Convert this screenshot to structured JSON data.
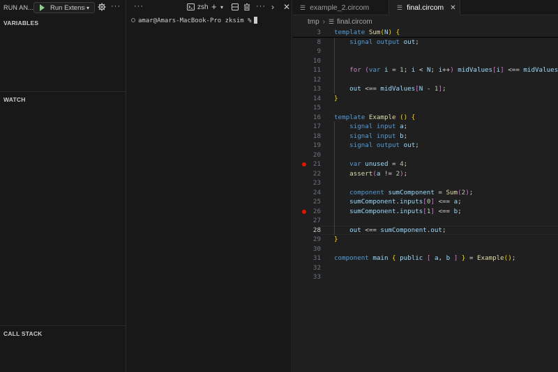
{
  "debug": {
    "title": "RUN AN...",
    "run_config": "Run Extensi",
    "more": "···",
    "sections": {
      "variables": "VARIABLES",
      "watch": "WATCH",
      "call_stack": "CALL STACK"
    }
  },
  "terminal": {
    "more": "···",
    "shell": "zsh",
    "plus": "+",
    "more2": "···",
    "prompt": "amar@Amars-MacBook-Pro zksim %"
  },
  "editor": {
    "tabs": [
      {
        "label": "example_2.circom",
        "active": false
      },
      {
        "label": "final.circom",
        "active": true
      }
    ],
    "breadcrumb": {
      "folder": "tmp",
      "file": "final.circom"
    },
    "lines": [
      {
        "n": "3",
        "tokens": [
          [
            "k",
            "template"
          ],
          [
            "o",
            " "
          ],
          [
            "f",
            "Sum"
          ],
          [
            "b1",
            "("
          ],
          [
            "v",
            "N"
          ],
          [
            "b1",
            ")"
          ],
          [
            "o",
            " "
          ],
          [
            "b1",
            "{"
          ]
        ],
        "sticky": true
      },
      {
        "n": "8",
        "tokens": [
          [
            "o",
            "    "
          ],
          [
            "k",
            "signal"
          ],
          [
            "o",
            " "
          ],
          [
            "k",
            "output"
          ],
          [
            "o",
            " "
          ],
          [
            "v",
            "out"
          ],
          [
            "o",
            ";"
          ]
        ]
      },
      {
        "n": "9",
        "tokens": []
      },
      {
        "n": "10",
        "tokens": []
      },
      {
        "n": "11",
        "tokens": [
          [
            "o",
            "    "
          ],
          [
            "kp",
            "for"
          ],
          [
            "o",
            " "
          ],
          [
            "b2",
            "("
          ],
          [
            "k",
            "var"
          ],
          [
            "o",
            " "
          ],
          [
            "v",
            "i"
          ],
          [
            "o",
            " = "
          ],
          [
            "n",
            "1"
          ],
          [
            "o",
            "; "
          ],
          [
            "v",
            "i"
          ],
          [
            "o",
            " < "
          ],
          [
            "v",
            "N"
          ],
          [
            "o",
            "; "
          ],
          [
            "v",
            "i"
          ],
          [
            "o",
            "++"
          ],
          [
            "b2",
            ")"
          ],
          [
            "o",
            " "
          ],
          [
            "v",
            "midValues"
          ],
          [
            "b2",
            "["
          ],
          [
            "v",
            "i"
          ],
          [
            "b2",
            "]"
          ],
          [
            "o",
            " <== "
          ],
          [
            "v",
            "midValues"
          ],
          [
            "b2",
            "["
          ]
        ]
      },
      {
        "n": "12",
        "tokens": []
      },
      {
        "n": "13",
        "tokens": [
          [
            "o",
            "    "
          ],
          [
            "v",
            "out"
          ],
          [
            "o",
            " <== "
          ],
          [
            "v",
            "midValues"
          ],
          [
            "b2",
            "["
          ],
          [
            "v",
            "N"
          ],
          [
            "o",
            " - "
          ],
          [
            "n",
            "1"
          ],
          [
            "b2",
            "]"
          ],
          [
            "o",
            ";"
          ]
        ]
      },
      {
        "n": "14",
        "tokens": [
          [
            "b1",
            "}"
          ]
        ]
      },
      {
        "n": "15",
        "tokens": []
      },
      {
        "n": "16",
        "tokens": [
          [
            "k",
            "template"
          ],
          [
            "o",
            " "
          ],
          [
            "f",
            "Example"
          ],
          [
            "o",
            " "
          ],
          [
            "b1",
            "()"
          ],
          [
            "o",
            " "
          ],
          [
            "b1",
            "{"
          ]
        ]
      },
      {
        "n": "17",
        "tokens": [
          [
            "o",
            "    "
          ],
          [
            "k",
            "signal"
          ],
          [
            "o",
            " "
          ],
          [
            "k",
            "input"
          ],
          [
            "o",
            " "
          ],
          [
            "v",
            "a"
          ],
          [
            "o",
            ";"
          ]
        ]
      },
      {
        "n": "18",
        "tokens": [
          [
            "o",
            "    "
          ],
          [
            "k",
            "signal"
          ],
          [
            "o",
            " "
          ],
          [
            "k",
            "input"
          ],
          [
            "o",
            " "
          ],
          [
            "v",
            "b"
          ],
          [
            "o",
            ";"
          ]
        ]
      },
      {
        "n": "19",
        "tokens": [
          [
            "o",
            "    "
          ],
          [
            "k",
            "signal"
          ],
          [
            "o",
            " "
          ],
          [
            "k",
            "output"
          ],
          [
            "o",
            " "
          ],
          [
            "v",
            "out"
          ],
          [
            "o",
            ";"
          ]
        ]
      },
      {
        "n": "20",
        "tokens": []
      },
      {
        "n": "21",
        "tokens": [
          [
            "o",
            "    "
          ],
          [
            "k",
            "var"
          ],
          [
            "o",
            " "
          ],
          [
            "v",
            "unused"
          ],
          [
            "o",
            " = "
          ],
          [
            "n",
            "4"
          ],
          [
            "o",
            ";"
          ]
        ],
        "breakpoint": true
      },
      {
        "n": "22",
        "tokens": [
          [
            "o",
            "    "
          ],
          [
            "f",
            "assert"
          ],
          [
            "b2",
            "("
          ],
          [
            "v",
            "a"
          ],
          [
            "o",
            " != "
          ],
          [
            "n",
            "2"
          ],
          [
            "b2",
            ")"
          ],
          [
            "o",
            ";"
          ]
        ]
      },
      {
        "n": "23",
        "tokens": []
      },
      {
        "n": "24",
        "tokens": [
          [
            "o",
            "    "
          ],
          [
            "k",
            "component"
          ],
          [
            "o",
            " "
          ],
          [
            "v",
            "sumComponent"
          ],
          [
            "o",
            " = "
          ],
          [
            "f",
            "Sum"
          ],
          [
            "b2",
            "("
          ],
          [
            "n",
            "2"
          ],
          [
            "b2",
            ")"
          ],
          [
            "o",
            ";"
          ]
        ]
      },
      {
        "n": "25",
        "tokens": [
          [
            "o",
            "    "
          ],
          [
            "v",
            "sumComponent"
          ],
          [
            "o",
            "."
          ],
          [
            "v",
            "inputs"
          ],
          [
            "b2",
            "["
          ],
          [
            "n",
            "0"
          ],
          [
            "b2",
            "]"
          ],
          [
            "o",
            " <== "
          ],
          [
            "v",
            "a"
          ],
          [
            "o",
            ";"
          ]
        ]
      },
      {
        "n": "26",
        "tokens": [
          [
            "o",
            "    "
          ],
          [
            "v",
            "sumComponent"
          ],
          [
            "o",
            "."
          ],
          [
            "v",
            "inputs"
          ],
          [
            "b2",
            "["
          ],
          [
            "n",
            "1"
          ],
          [
            "b2",
            "]"
          ],
          [
            "o",
            " <== "
          ],
          [
            "v",
            "b"
          ],
          [
            "o",
            ";"
          ]
        ],
        "breakpoint": true
      },
      {
        "n": "27",
        "tokens": []
      },
      {
        "n": "28",
        "tokens": [
          [
            "o",
            "    "
          ],
          [
            "v",
            "out"
          ],
          [
            "o",
            " <== "
          ],
          [
            "v",
            "sumComponent"
          ],
          [
            "o",
            "."
          ],
          [
            "v",
            "out"
          ],
          [
            "o",
            ";"
          ]
        ],
        "current": true
      },
      {
        "n": "29",
        "tokens": [
          [
            "b1",
            "}"
          ]
        ]
      },
      {
        "n": "30",
        "tokens": []
      },
      {
        "n": "31",
        "tokens": [
          [
            "k",
            "component"
          ],
          [
            "o",
            " "
          ],
          [
            "v",
            "main"
          ],
          [
            "o",
            " "
          ],
          [
            "b1",
            "{"
          ],
          [
            "o",
            " "
          ],
          [
            "v",
            "public"
          ],
          [
            "o",
            " "
          ],
          [
            "b2",
            "["
          ],
          [
            "o",
            " "
          ],
          [
            "v",
            "a"
          ],
          [
            "o",
            ", "
          ],
          [
            "v",
            "b"
          ],
          [
            "o",
            " "
          ],
          [
            "b2",
            "]"
          ],
          [
            "o",
            " "
          ],
          [
            "b1",
            "}"
          ],
          [
            "o",
            " = "
          ],
          [
            "f",
            "Example"
          ],
          [
            "b1",
            "()"
          ],
          [
            "o",
            ";"
          ]
        ]
      },
      {
        "n": "32",
        "tokens": []
      },
      {
        "n": "33",
        "tokens": []
      }
    ]
  },
  "colors": {
    "background": "#181818",
    "editor_bg": "#1f1f1f",
    "breakpoint": "#e51400",
    "run_green": "#89d185"
  },
  "icons": [
    "play-icon",
    "gear-icon",
    "terminal-icon",
    "trash-icon",
    "split-icon",
    "file-icon",
    "close-icon",
    "chevron-right-icon"
  ]
}
